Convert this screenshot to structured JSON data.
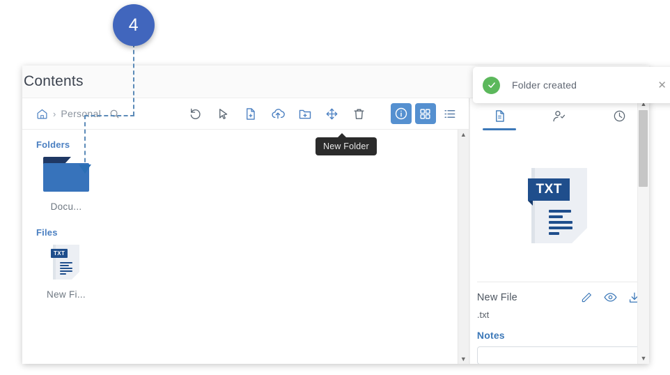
{
  "annotation": {
    "step_number": "4"
  },
  "window": {
    "title": "Contents"
  },
  "toolbar": {
    "breadcrumb": {
      "home_icon": "home-icon",
      "separator": "›",
      "current": "Personal"
    },
    "search_icon": "search-icon",
    "actions": [
      {
        "name": "refresh",
        "icon": "refresh-icon"
      },
      {
        "name": "select",
        "icon": "cursor-icon"
      },
      {
        "name": "new-file",
        "icon": "new-file-icon"
      },
      {
        "name": "upload",
        "icon": "upload-cloud-icon"
      },
      {
        "name": "new-folder",
        "icon": "new-folder-icon"
      },
      {
        "name": "move",
        "icon": "move-icon"
      },
      {
        "name": "delete",
        "icon": "trash-icon"
      }
    ],
    "views": [
      {
        "name": "info",
        "icon": "info-icon",
        "active": true
      },
      {
        "name": "grid",
        "icon": "grid-icon",
        "active": true
      },
      {
        "name": "list",
        "icon": "list-icon",
        "active": false
      }
    ]
  },
  "tooltip": {
    "text": "New Folder"
  },
  "toast": {
    "message": "Folder created",
    "icon": "check-circle-icon",
    "close_icon": "close-icon",
    "accent_color": "#5cb85c"
  },
  "browser": {
    "folders_label": "Folders",
    "folders": [
      {
        "label": "Docu...",
        "icon": "folder-icon"
      }
    ],
    "files_label": "Files",
    "files": [
      {
        "label": "New Fi...",
        "icon": "txt-file-icon",
        "badge": "TXT"
      }
    ]
  },
  "detail": {
    "tabs": [
      {
        "name": "details",
        "icon": "document-icon",
        "active": true
      },
      {
        "name": "sharing",
        "icon": "person-check-icon",
        "active": false
      },
      {
        "name": "history",
        "icon": "clock-icon",
        "active": false
      }
    ],
    "preview": {
      "badge": "TXT",
      "icon": "txt-file-icon"
    },
    "name": "New File",
    "extension": ".txt",
    "actions": [
      {
        "name": "edit",
        "icon": "pencil-icon"
      },
      {
        "name": "preview",
        "icon": "eye-icon"
      },
      {
        "name": "download",
        "icon": "download-icon"
      }
    ],
    "notes_label": "Notes",
    "notes_value": ""
  },
  "colors": {
    "accent_blue": "#3c78b8",
    "active_blue": "#5590d0",
    "folder_blue": "#3773bb",
    "badge_blue": "#4166bd",
    "success_green": "#5cb85c",
    "dashed_line": "#5b8ab8"
  }
}
